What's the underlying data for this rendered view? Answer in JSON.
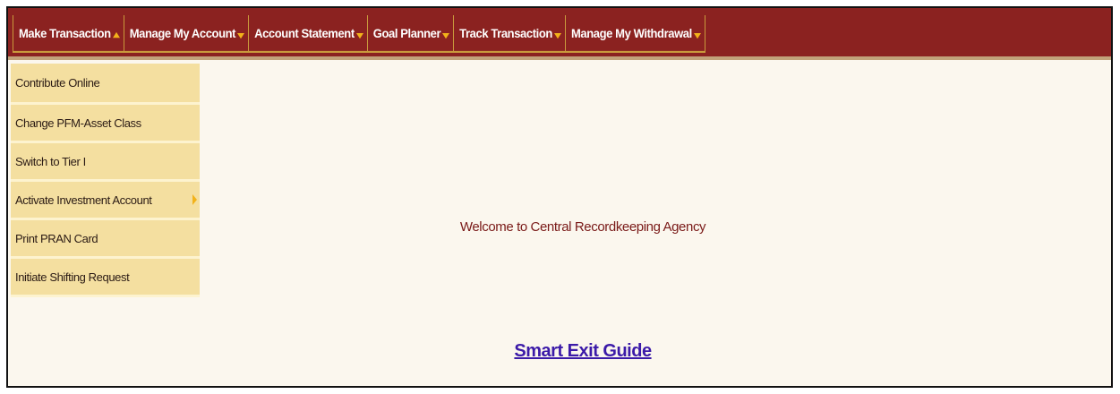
{
  "menu": {
    "items": [
      {
        "label": "Make Transaction"
      },
      {
        "label": "Manage My Account"
      },
      {
        "label": "Account Statement"
      },
      {
        "label": "Goal Planner"
      },
      {
        "label": "Track Transaction"
      },
      {
        "label": "Manage My Withdrawal"
      }
    ]
  },
  "dropdown": {
    "items": [
      {
        "label": "Contribute Online"
      },
      {
        "label": "Change PFM-Asset Class"
      },
      {
        "label": "Switch to Tier I"
      },
      {
        "label": "Activate Investment Account"
      },
      {
        "label": "Print PRAN Card"
      },
      {
        "label": "Initiate Shifting Request"
      }
    ]
  },
  "main": {
    "welcome_text": "Welcome to Central Recordkeeping Agency",
    "exit_link_label": "Smart Exit Guide"
  },
  "colors": {
    "menubar_bg": "#8b2220",
    "dropdown_bg": "#f4dfa0",
    "accent_arrow": "#f2b21a",
    "welcome_text": "#7a1a18",
    "link": "#3b1aa8"
  },
  "icons": {
    "menu_open": "caret-up-icon",
    "menu_closed": "caret-down-icon",
    "submenu": "caret-right-icon"
  }
}
